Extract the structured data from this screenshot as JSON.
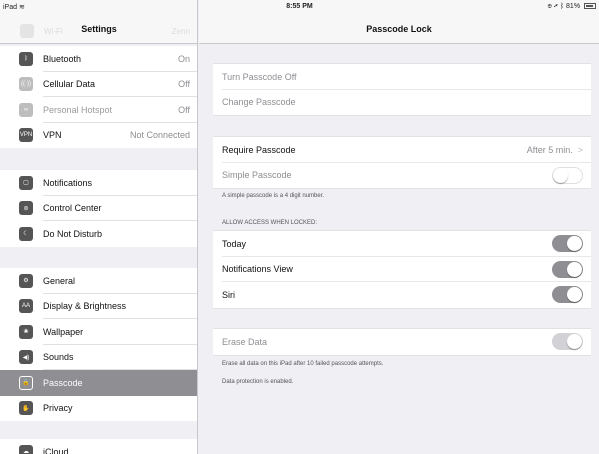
{
  "status_bar": {
    "device": "iPad",
    "time": "8:55 PM",
    "battery_text": "81%"
  },
  "sidebar": {
    "title": "Settings",
    "ghost_wifi": "Wi-Fi",
    "ghost_network": "Zenn",
    "groups": [
      [
        {
          "label": "Bluetooth",
          "value": "On",
          "icon": "bluetooth-icon",
          "glyph": "ᛒ"
        },
        {
          "label": "Cellular Data",
          "value": "Off",
          "icon": "cellular-icon",
          "glyph": "((·))",
          "dim_icon": true
        },
        {
          "label": "Personal Hotspot",
          "value": "Off",
          "icon": "hotspot-icon",
          "glyph": "∞",
          "dim": true
        },
        {
          "label": "VPN",
          "value": "Not Connected",
          "icon": "vpn-icon",
          "glyph": "VPN"
        }
      ],
      [
        {
          "label": "Notifications",
          "icon": "notifications-icon",
          "glyph": "▢"
        },
        {
          "label": "Control Center",
          "icon": "control-center-icon",
          "glyph": "⊜"
        },
        {
          "label": "Do Not Disturb",
          "icon": "moon-icon",
          "glyph": "☾"
        }
      ],
      [
        {
          "label": "General",
          "icon": "gear-icon",
          "glyph": "⚙"
        },
        {
          "label": "Display & Brightness",
          "icon": "display-icon",
          "glyph": "AA"
        },
        {
          "label": "Wallpaper",
          "icon": "wallpaper-icon",
          "glyph": "❀"
        },
        {
          "label": "Sounds",
          "icon": "speaker-icon",
          "glyph": "◀)"
        },
        {
          "label": "Passcode",
          "icon": "lock-icon",
          "glyph": "🔒",
          "selected": true
        },
        {
          "label": "Privacy",
          "icon": "hand-icon",
          "glyph": "✋"
        }
      ],
      [
        {
          "label": "iCloud",
          "icon": "cloud-icon",
          "glyph": "☁"
        }
      ]
    ]
  },
  "main": {
    "title": "Passcode Lock",
    "turn_off": "Turn Passcode Off",
    "change": "Change Passcode",
    "require_label": "Require Passcode",
    "require_value": "After 5 min.",
    "simple_label": "Simple Passcode",
    "simple_note": "A simple passcode is a 4 digit number.",
    "allow_header": "ALLOW ACCESS WHEN LOCKED:",
    "today": "Today",
    "notifications_view": "Notifications View",
    "siri": "Siri",
    "erase_label": "Erase Data",
    "erase_note": "Erase all data on this iPad after 10 failed passcode attempts.",
    "protection_note": "Data protection is enabled.",
    "toggles": {
      "simple": false,
      "today": true,
      "notifications_view": true,
      "siri": true,
      "erase": true
    }
  }
}
